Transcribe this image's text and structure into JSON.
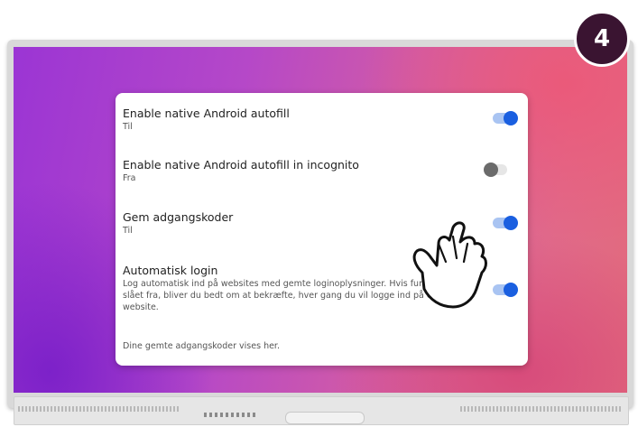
{
  "step_badge": "4",
  "settings": [
    {
      "title": "Enable native Android autofill",
      "status": "Til",
      "toggle": "on"
    },
    {
      "title": "Enable native Android autofill in incognito",
      "status": "Fra",
      "toggle": "off"
    },
    {
      "title": "Gem adgangskoder",
      "status": "Til",
      "toggle": "on"
    },
    {
      "title": "Automatisk login",
      "description": "Log automatisk ind på websites med gemte loginoplysninger. Hvis funktionen er slået fra, bliver du bedt om at bekræfte, hver gang du vil logge ind på et website.",
      "toggle": "on"
    }
  ],
  "footer_text": "Dine gemte adgangskoder vises her.",
  "colors": {
    "toggle_on_knob": "#1a5fe0",
    "toggle_on_track": "#a9c4f2",
    "toggle_off_knob": "#6b6b6b",
    "badge_bg": "#3a1431"
  },
  "icons": {
    "pointer": "hand-pointer-icon"
  }
}
